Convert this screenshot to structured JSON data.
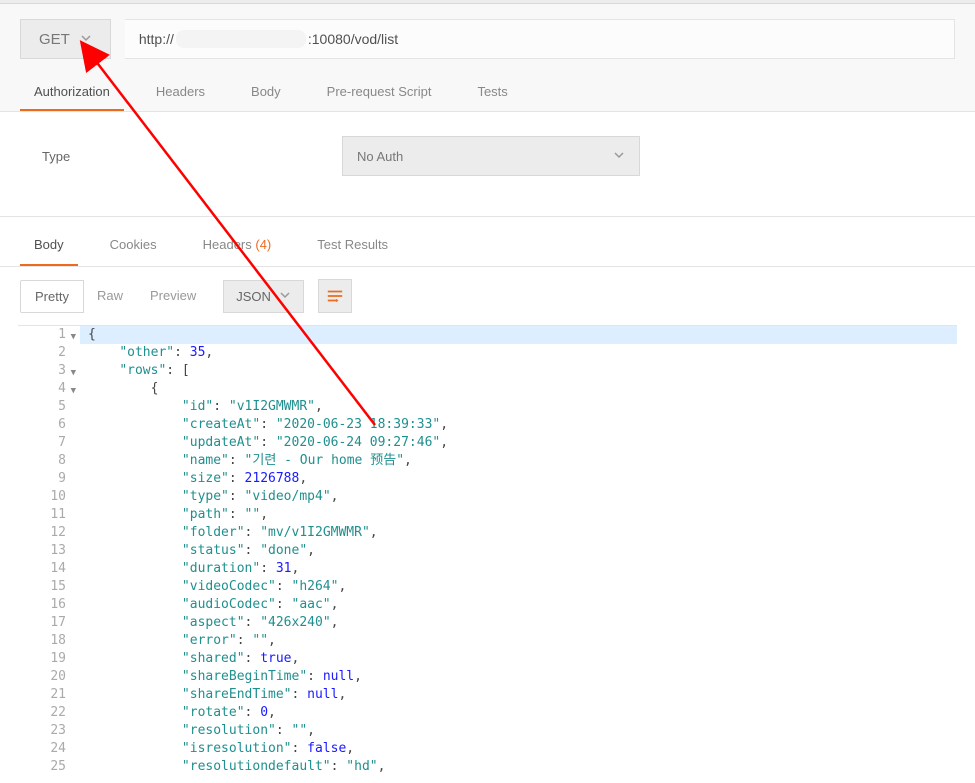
{
  "request": {
    "method": "GET",
    "url_prefix": "http://",
    "url_suffix": ":10080/vod/list"
  },
  "req_tabs": [
    "Authorization",
    "Headers",
    "Body",
    "Pre-request Script",
    "Tests"
  ],
  "req_tab_active": 0,
  "auth": {
    "label": "Type",
    "value": "No Auth"
  },
  "resp_tabs": {
    "items": [
      "Body",
      "Cookies",
      "Headers",
      "Test Results"
    ],
    "headers_count": "(4)",
    "active": 0
  },
  "viewer": {
    "modes": [
      "Pretty",
      "Raw",
      "Preview"
    ],
    "mode_active": 0,
    "format": "JSON"
  },
  "code_lines": [
    {
      "n": 1,
      "fold": true,
      "tokens": [
        [
          "{",
          "punc"
        ]
      ]
    },
    {
      "n": 2,
      "tokens": [
        [
          "    ",
          ""
        ],
        [
          "\"other\"",
          "key"
        ],
        [
          ": ",
          "punc"
        ],
        [
          "35",
          "num"
        ],
        [
          ",",
          "punc"
        ]
      ]
    },
    {
      "n": 3,
      "fold": true,
      "tokens": [
        [
          "    ",
          ""
        ],
        [
          "\"rows\"",
          "key"
        ],
        [
          ": [",
          "punc"
        ]
      ]
    },
    {
      "n": 4,
      "fold": true,
      "tokens": [
        [
          "        {",
          "punc"
        ]
      ]
    },
    {
      "n": 5,
      "tokens": [
        [
          "            ",
          ""
        ],
        [
          "\"id\"",
          "key"
        ],
        [
          ": ",
          "punc"
        ],
        [
          "\"v1I2GMWMR\"",
          "str"
        ],
        [
          ",",
          "punc"
        ]
      ]
    },
    {
      "n": 6,
      "tokens": [
        [
          "            ",
          ""
        ],
        [
          "\"createAt\"",
          "key"
        ],
        [
          ": ",
          "punc"
        ],
        [
          "\"2020-06-23 18:39:33\"",
          "str"
        ],
        [
          ",",
          "punc"
        ]
      ]
    },
    {
      "n": 7,
      "tokens": [
        [
          "            ",
          ""
        ],
        [
          "\"updateAt\"",
          "key"
        ],
        [
          ": ",
          "punc"
        ],
        [
          "\"2020-06-24 09:27:46\"",
          "str"
        ],
        [
          ",",
          "punc"
        ]
      ]
    },
    {
      "n": 8,
      "tokens": [
        [
          "            ",
          ""
        ],
        [
          "\"name\"",
          "key"
        ],
        [
          ": ",
          "punc"
        ],
        [
          "\"기련 - Our home 预告\"",
          "str"
        ],
        [
          ",",
          "punc"
        ]
      ]
    },
    {
      "n": 9,
      "tokens": [
        [
          "            ",
          ""
        ],
        [
          "\"size\"",
          "key"
        ],
        [
          ": ",
          "punc"
        ],
        [
          "2126788",
          "num"
        ],
        [
          ",",
          "punc"
        ]
      ]
    },
    {
      "n": 10,
      "tokens": [
        [
          "            ",
          ""
        ],
        [
          "\"type\"",
          "key"
        ],
        [
          ": ",
          "punc"
        ],
        [
          "\"video/mp4\"",
          "str"
        ],
        [
          ",",
          "punc"
        ]
      ]
    },
    {
      "n": 11,
      "tokens": [
        [
          "            ",
          ""
        ],
        [
          "\"path\"",
          "key"
        ],
        [
          ": ",
          "punc"
        ],
        [
          "\"\"",
          "str"
        ],
        [
          ",",
          "punc"
        ]
      ]
    },
    {
      "n": 12,
      "tokens": [
        [
          "            ",
          ""
        ],
        [
          "\"folder\"",
          "key"
        ],
        [
          ": ",
          "punc"
        ],
        [
          "\"mv/v1I2GMWMR\"",
          "str"
        ],
        [
          ",",
          "punc"
        ]
      ]
    },
    {
      "n": 13,
      "tokens": [
        [
          "            ",
          ""
        ],
        [
          "\"status\"",
          "key"
        ],
        [
          ": ",
          "punc"
        ],
        [
          "\"done\"",
          "str"
        ],
        [
          ",",
          "punc"
        ]
      ]
    },
    {
      "n": 14,
      "tokens": [
        [
          "            ",
          ""
        ],
        [
          "\"duration\"",
          "key"
        ],
        [
          ": ",
          "punc"
        ],
        [
          "31",
          "num"
        ],
        [
          ",",
          "punc"
        ]
      ]
    },
    {
      "n": 15,
      "tokens": [
        [
          "            ",
          ""
        ],
        [
          "\"videoCodec\"",
          "key"
        ],
        [
          ": ",
          "punc"
        ],
        [
          "\"h264\"",
          "str"
        ],
        [
          ",",
          "punc"
        ]
      ]
    },
    {
      "n": 16,
      "tokens": [
        [
          "            ",
          ""
        ],
        [
          "\"audioCodec\"",
          "key"
        ],
        [
          ": ",
          "punc"
        ],
        [
          "\"aac\"",
          "str"
        ],
        [
          ",",
          "punc"
        ]
      ]
    },
    {
      "n": 17,
      "tokens": [
        [
          "            ",
          ""
        ],
        [
          "\"aspect\"",
          "key"
        ],
        [
          ": ",
          "punc"
        ],
        [
          "\"426x240\"",
          "str"
        ],
        [
          ",",
          "punc"
        ]
      ]
    },
    {
      "n": 18,
      "tokens": [
        [
          "            ",
          ""
        ],
        [
          "\"error\"",
          "key"
        ],
        [
          ": ",
          "punc"
        ],
        [
          "\"\"",
          "str"
        ],
        [
          ",",
          "punc"
        ]
      ]
    },
    {
      "n": 19,
      "tokens": [
        [
          "            ",
          ""
        ],
        [
          "\"shared\"",
          "key"
        ],
        [
          ": ",
          "punc"
        ],
        [
          "true",
          "lit"
        ],
        [
          ",",
          "punc"
        ]
      ]
    },
    {
      "n": 20,
      "tokens": [
        [
          "            ",
          ""
        ],
        [
          "\"shareBeginTime\"",
          "key"
        ],
        [
          ": ",
          "punc"
        ],
        [
          "null",
          "lit"
        ],
        [
          ",",
          "punc"
        ]
      ]
    },
    {
      "n": 21,
      "tokens": [
        [
          "            ",
          ""
        ],
        [
          "\"shareEndTime\"",
          "key"
        ],
        [
          ": ",
          "punc"
        ],
        [
          "null",
          "lit"
        ],
        [
          ",",
          "punc"
        ]
      ]
    },
    {
      "n": 22,
      "tokens": [
        [
          "            ",
          ""
        ],
        [
          "\"rotate\"",
          "key"
        ],
        [
          ": ",
          "punc"
        ],
        [
          "0",
          "num"
        ],
        [
          ",",
          "punc"
        ]
      ]
    },
    {
      "n": 23,
      "tokens": [
        [
          "            ",
          ""
        ],
        [
          "\"resolution\"",
          "key"
        ],
        [
          ": ",
          "punc"
        ],
        [
          "\"\"",
          "str"
        ],
        [
          ",",
          "punc"
        ]
      ]
    },
    {
      "n": 24,
      "tokens": [
        [
          "            ",
          ""
        ],
        [
          "\"isresolution\"",
          "key"
        ],
        [
          ": ",
          "punc"
        ],
        [
          "false",
          "lit"
        ],
        [
          ",",
          "punc"
        ]
      ]
    },
    {
      "n": 25,
      "tokens": [
        [
          "            ",
          ""
        ],
        [
          "\"resolutiondefault\"",
          "key"
        ],
        [
          ": ",
          "punc"
        ],
        [
          "\"hd\"",
          "str"
        ],
        [
          ",",
          "punc"
        ]
      ]
    }
  ]
}
